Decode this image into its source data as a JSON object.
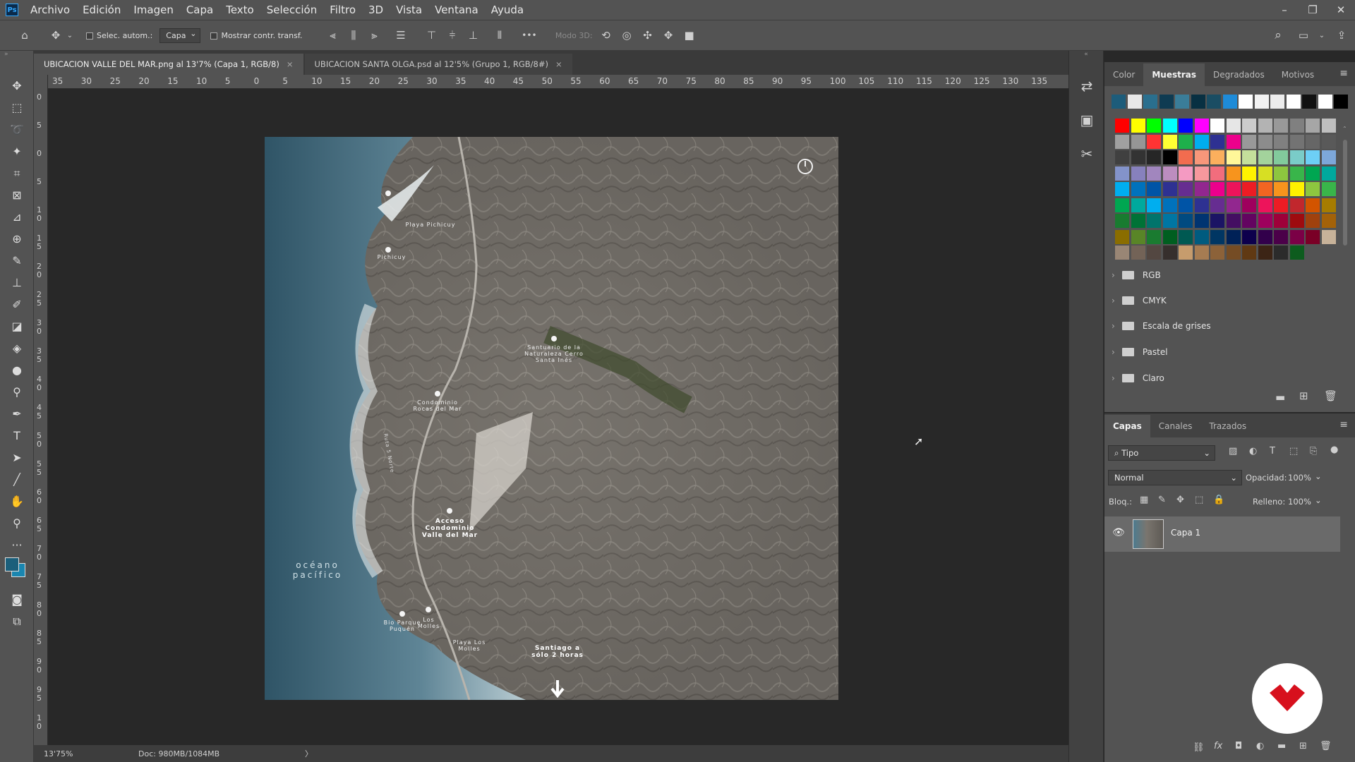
{
  "menubar": {
    "logo": "Ps",
    "items": [
      "Archivo",
      "Edición",
      "Imagen",
      "Capa",
      "Texto",
      "Selección",
      "Filtro",
      "3D",
      "Vista",
      "Ventana",
      "Ayuda"
    ],
    "window_controls": [
      "–",
      "❐",
      "✕"
    ]
  },
  "options": {
    "auto_select_label": "Selec. autom.:",
    "auto_select_target": "Capa",
    "show_transform_label": "Mostrar contr. transf.",
    "mode3d_label": "Modo 3D:",
    "more": "•••"
  },
  "tabs": [
    {
      "label": "UBICACION VALLE DEL MAR.png al 13'7% (Capa 1, RGB/8)",
      "close": "×"
    },
    {
      "label": "UBICACION SANTA OLGA.psd al 12'5% (Grupo 1, RGB/8#)",
      "close": "×"
    }
  ],
  "ruler_top": [
    "35",
    "30",
    "25",
    "20",
    "15",
    "10",
    "5",
    "0",
    "5",
    "10",
    "15",
    "20",
    "25",
    "30",
    "35",
    "40",
    "45",
    "50",
    "55",
    "60",
    "65",
    "70",
    "75",
    "80",
    "85",
    "90",
    "95",
    "100",
    "105",
    "110",
    "115",
    "120",
    "125",
    "130",
    "135"
  ],
  "ruler_left": [
    "0",
    "5",
    "0",
    "5",
    "1 0",
    "1 5",
    "2 0",
    "2 5",
    "3 0",
    "3 5",
    "4 0",
    "4 5",
    "5 0",
    "5 5",
    "6 0",
    "6 5",
    "7 0",
    "7 5",
    "8 0",
    "8 5",
    "9 0",
    "9 5",
    "1 0"
  ],
  "map_labels": {
    "playa_pichicuy": "Playa Pichicuy",
    "pichicuy": "Pichicuy",
    "santuario": "Santuario de la Naturaleza Cerro Santa Inés",
    "condominio_rocas": "Condominio Rocas del Mar",
    "acceso": "Acceso Condominio Valle del Mar",
    "oceano": "océano pacífico",
    "parque": "Bio Parque Puquén",
    "los_molles": "Los Molles",
    "playa_molles": "Playa Los Molles",
    "santiago": "Santiago a sólo 2 horas",
    "road": "Ruta 5 Norte"
  },
  "status": {
    "zoom": "13'75%",
    "doc": "Doc: 980MB/1084MB",
    "arrow": "〉"
  },
  "swatches_panel": {
    "tabs": [
      "Color",
      "Muestras",
      "Degradados",
      "Motivos"
    ],
    "active_tab": "Muestras",
    "recent": [
      "#1d5c7a",
      "#e8e8e8",
      "#2a6f8e",
      "#0e3b52",
      "#3a7d99",
      "#083042",
      "#1a4d63",
      "#1e8bd8",
      "#ffffff",
      "#f2f2f2",
      "#ececec",
      "#ffffff",
      "#111111",
      "#ffffff",
      "#000000"
    ],
    "grid": [
      [
        "#ff0000",
        "#ffff00",
        "#00ff00",
        "#00ffff",
        "#0000ff",
        "#ff00ff",
        "#ffffff",
        "#e6e6e6",
        "#cccccc",
        "#b3b3b3",
        "#999999",
        "#808080",
        "#a6a6a6",
        "#bfbfbf"
      ],
      [
        "#a0a0a0",
        "#969696",
        "#ff3333",
        "#ffff33",
        "#1eb04b",
        "#00aeef",
        "#2e3192",
        "#ec008c",
        "#999999",
        "#8c8c8c",
        "#808080",
        "#737373",
        "#666666",
        "#595959"
      ],
      [
        "#404040",
        "#333333",
        "#262626",
        "#000000",
        "#f26c4f",
        "#f7977a",
        "#fbaf5d",
        "#fff799",
        "#c4df9b",
        "#a3d39c",
        "#82ca9c",
        "#7accc8",
        "#6dcff6",
        "#7da7d9"
      ],
      [
        "#8393ca",
        "#8781bd",
        "#a186be",
        "#bc8dbf",
        "#f49ac2",
        "#f6989d",
        "#f26d7d",
        "#f7941d",
        "#fff200",
        "#d7df23",
        "#8dc63f",
        "#39b54a",
        "#00a651",
        "#00a99d"
      ],
      [
        "#00aeef",
        "#0072bc",
        "#0054a6",
        "#2e3192",
        "#662d91",
        "#92278f",
        "#ec008c",
        "#ed145b",
        "#ed1c24",
        "#f26522",
        "#f7941d",
        "#fff200",
        "#8dc63f",
        "#39b54a"
      ],
      [
        "#00a651",
        "#00a99d",
        "#00aeef",
        "#0072bc",
        "#0054a6",
        "#2e3192",
        "#662d91",
        "#92278f",
        "#9e005d",
        "#ed145b",
        "#ed1c24",
        "#c1272d",
        "#d35400",
        "#a67c00"
      ],
      [
        "#197b30",
        "#007236",
        "#00746b",
        "#0076a3",
        "#004a80",
        "#003471",
        "#1b1464",
        "#440e62",
        "#630460",
        "#9e005d",
        "#9e0039",
        "#9e0b0f",
        "#a0410d",
        "#a36209"
      ],
      [
        "#8a6d00",
        "#598527",
        "#1a7b30",
        "#005e20",
        "#005952",
        "#005b7f",
        "#003663",
        "#002157",
        "#0d004c",
        "#32004b",
        "#4b0049",
        "#7b0046",
        "#7a0026",
        "#c7b299"
      ],
      [
        "#998675",
        "#736357",
        "#534741",
        "#362f2d",
        "#c69c6d",
        "#a67c52",
        "#8c6239",
        "#754c24",
        "#603913",
        "#3c2415",
        "#2b2b2b",
        "#0d5c1e"
      ]
    ],
    "folders": [
      "RGB",
      "CMYK",
      "Escala de grises",
      "Pastel",
      "Claro"
    ]
  },
  "layers_panel": {
    "tabs": [
      "Capas",
      "Canales",
      "Trazados"
    ],
    "active_tab": "Capas",
    "filter_label": "Tipo",
    "blend_mode": "Normal",
    "opacity_label": "Opacidad:",
    "opacity_value": "100%",
    "lock_label": "Bloq.:",
    "fill_label": "Relleno:",
    "fill_value": "100%",
    "layers": [
      {
        "name": "Capa 1",
        "visible": true
      }
    ]
  }
}
